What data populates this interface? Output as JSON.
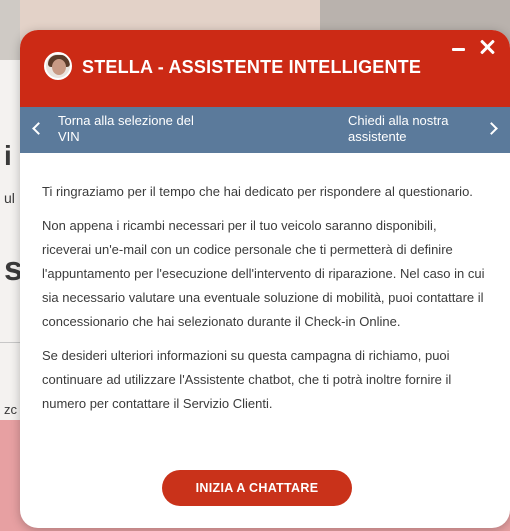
{
  "modal": {
    "title": "STELLA - ASSISTENTE INTELLIGENTE",
    "nav": {
      "back_label": "Torna alla selezione del VIN",
      "forward_label": "Chiedi alla nostra assistente"
    },
    "paragraphs": [
      "Ti ringraziamo per il tempo che hai dedicato per rispondere al questionario.",
      "Non appena i ricambi necessari per il tuo veicolo saranno disponibili, riceverai un'e-mail con un codice personale che ti permetterà di definire l'appuntamento per l'esecuzione dell'intervento di riparazione. Nel caso in cui sia necessario valutare una eventuale soluzione di mobilità, puoi contattare il concessionario che hai selezionato durante il Check-in Online.",
      "Se desideri ulteriori informazioni su questa campagna di richiamo, puoi continuare ad utilizzare l'Assistente chatbot, che ti potrà inoltre fornire il numero per contattare il Servizio Clienti."
    ],
    "cta_label": "INIZIA A CHATTARE"
  },
  "colors": {
    "header_red": "#cc2a15",
    "nav_blue": "#5b7a9b",
    "button_red": "#c9321a"
  },
  "icons": [
    "avatar-photo",
    "minimize-icon",
    "close-icon",
    "chevron-left-icon",
    "chevron-right-icon"
  ]
}
